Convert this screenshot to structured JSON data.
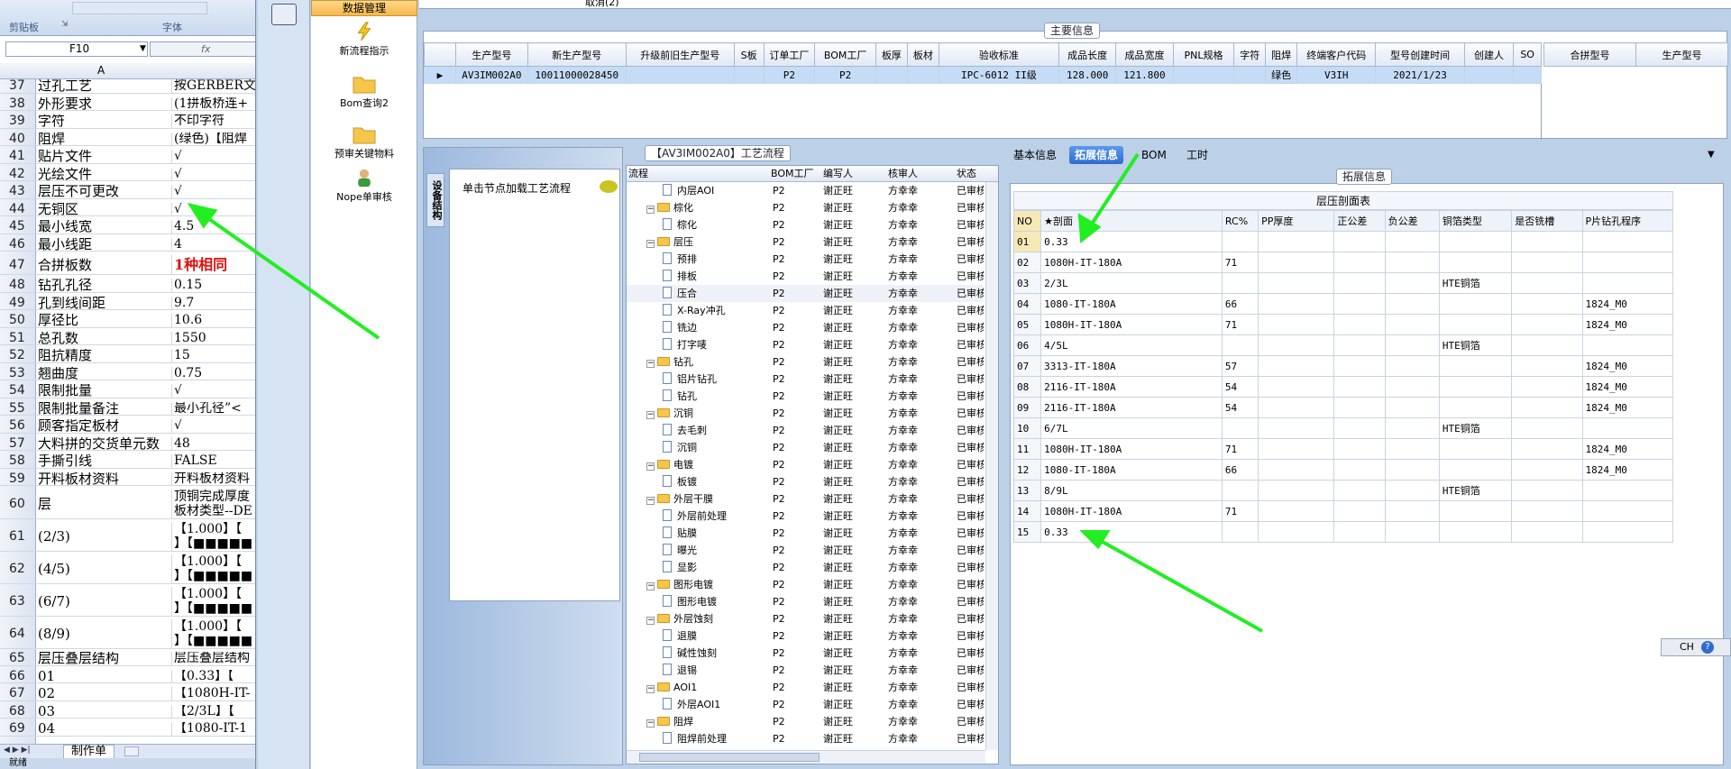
{
  "excel": {
    "ribbon": {
      "clipboard": "剪贴板",
      "font": "字体"
    },
    "namebox": "F10",
    "fx": "fx",
    "col_a": "A",
    "rows": [
      {
        "n": "37",
        "a": "过孔工艺",
        "b": "按GERBER文件"
      },
      {
        "n": "38",
        "a": "外形要求",
        "b": "(1拼板桥连+"
      },
      {
        "n": "39",
        "a": "字符",
        "b": "不印字符"
      },
      {
        "n": "40",
        "a": "阻焊",
        "b": "(绿色)【阻焊"
      },
      {
        "n": "41",
        "a": "贴片文件",
        "b": "√"
      },
      {
        "n": "42",
        "a": "光绘文件",
        "b": "√"
      },
      {
        "n": "43",
        "a": "层压不可更改",
        "b": "√"
      },
      {
        "n": "44",
        "a": "无铜区",
        "b": "√"
      },
      {
        "n": "45",
        "a": "最小线宽",
        "b": "4.5"
      },
      {
        "n": "46",
        "a": "最小线距",
        "b": "4"
      },
      {
        "n": "47",
        "a": "合拼板数",
        "b": "1种相同"
      },
      {
        "n": "48",
        "a": "钻孔孔径",
        "b": "0.15"
      },
      {
        "n": "49",
        "a": "孔到线间距",
        "b": "9.7"
      },
      {
        "n": "50",
        "a": "厚径比",
        "b": "10.6"
      },
      {
        "n": "51",
        "a": "总孔数",
        "b": "1550"
      },
      {
        "n": "52",
        "a": "阻抗精度",
        "b": "15"
      },
      {
        "n": "53",
        "a": "翘曲度",
        "b": "0.75"
      },
      {
        "n": "54",
        "a": "限制批量",
        "b": "√"
      },
      {
        "n": "55",
        "a": "限制批量备注",
        "b": "最小孔径”<"
      },
      {
        "n": "56",
        "a": "顾客指定板材",
        "b": "√"
      },
      {
        "n": "57",
        "a": "大料拼的交货单元数",
        "b": "48"
      },
      {
        "n": "58",
        "a": "手撕引线",
        "b": "FALSE"
      },
      {
        "n": "59",
        "a": "开料板材资料",
        "b": "开料板材资料"
      },
      {
        "n": "60",
        "a": "层",
        "b": "顶铜完成厚度",
        "b2": "板材类型--DE"
      },
      {
        "n": "61",
        "a": "(2/3)",
        "b": "【1.000】【",
        "b2": "】【■■■■■"
      },
      {
        "n": "62",
        "a": "(4/5)",
        "b": "【1.000】【",
        "b2": "】【■■■■■"
      },
      {
        "n": "63",
        "a": "(6/7)",
        "b": "【1.000】【",
        "b2": "】【■■■■■"
      },
      {
        "n": "64",
        "a": "(8/9)",
        "b": "【1.000】【",
        "b2": "】【■■■■■"
      },
      {
        "n": "65",
        "a": "层压叠层结构",
        "b": "层压叠层结构"
      },
      {
        "n": "66",
        "a": "01",
        "b": "【0.33】【"
      },
      {
        "n": "67",
        "a": "02",
        "b": "【1080H-IT-"
      },
      {
        "n": "68",
        "a": "03",
        "b": "【2/3L】【"
      },
      {
        "n": "69",
        "a": "04",
        "b": "【1080-IT-1"
      }
    ],
    "sheet_tab": "制作单",
    "status": "就绪"
  },
  "nav": {
    "top_tab": "数据管理",
    "items": [
      "新流程指示",
      "Bom查询2",
      "预审关键物料",
      "Nope单审核"
    ]
  },
  "main": {
    "top_cut": "取消(2)",
    "info_caption": "主要信息",
    "info_headers": [
      "生产型号",
      "新生产型号",
      "升级前旧生产型号",
      "S板",
      "订单工厂",
      "BOM工厂",
      "板厚",
      "板材",
      "验收标准",
      "成品长度",
      "成品宽度",
      "PNL规格",
      "字符",
      "阻焊",
      "终端客户代码",
      "型号创建时间",
      "创建人",
      "SO"
    ],
    "info_row": [
      "AV3IM002A0",
      "10011000028450",
      "",
      "",
      "P2",
      "P2",
      "",
      "",
      "IPC-6012 II级",
      "128.000",
      "121.800",
      "",
      "",
      "绿色",
      "V3IH",
      "2021/1/23",
      "",
      ""
    ],
    "merge_headers": [
      "合拼型号",
      "生产型号"
    ],
    "flow_caption": "【AV3IM002A0】工艺流程",
    "side_tab": "设备结构",
    "click_hint": "单击节点加载工艺流程",
    "tree_headers": [
      "流程",
      "BOM工厂",
      "编写人",
      "核审人",
      "状态"
    ],
    "tree": [
      {
        "lvl": 2,
        "type": "doc",
        "name": "内层AOI",
        "f": "P2",
        "w": "谢正旺",
        "r": "方幸幸",
        "s": "已审核"
      },
      {
        "lvl": 1,
        "type": "folder",
        "name": "棕化",
        "f": "P2",
        "w": "谢正旺",
        "r": "方幸幸",
        "s": "已审核"
      },
      {
        "lvl": 2,
        "type": "doc",
        "name": "棕化",
        "f": "P2",
        "w": "谢正旺",
        "r": "方幸幸",
        "s": "已审核"
      },
      {
        "lvl": 1,
        "type": "folder",
        "name": "层压",
        "f": "P2",
        "w": "谢正旺",
        "r": "方幸幸",
        "s": "已审核"
      },
      {
        "lvl": 2,
        "type": "doc",
        "name": "预排",
        "f": "P2",
        "w": "谢正旺",
        "r": "方幸幸",
        "s": "已审核"
      },
      {
        "lvl": 2,
        "type": "doc",
        "name": "排板",
        "f": "P2",
        "w": "谢正旺",
        "r": "方幸幸",
        "s": "已审核"
      },
      {
        "lvl": 2,
        "type": "doc",
        "name": "压合",
        "f": "P2",
        "w": "谢正旺",
        "r": "方幸幸",
        "s": "已审核"
      },
      {
        "lvl": 2,
        "type": "doc",
        "name": "X-Ray冲孔",
        "f": "P2",
        "w": "谢正旺",
        "r": "方幸幸",
        "s": "已审核"
      },
      {
        "lvl": 2,
        "type": "doc",
        "name": "铣边",
        "f": "P2",
        "w": "谢正旺",
        "r": "方幸幸",
        "s": "已审核"
      },
      {
        "lvl": 2,
        "type": "doc",
        "name": "打字唛",
        "f": "P2",
        "w": "谢正旺",
        "r": "方幸幸",
        "s": "已审核"
      },
      {
        "lvl": 1,
        "type": "folder",
        "name": "钻孔",
        "f": "P2",
        "w": "谢正旺",
        "r": "方幸幸",
        "s": "已审核"
      },
      {
        "lvl": 2,
        "type": "doc",
        "name": "铝片钻孔",
        "f": "P2",
        "w": "谢正旺",
        "r": "方幸幸",
        "s": "已审核"
      },
      {
        "lvl": 2,
        "type": "doc",
        "name": "钻孔",
        "f": "P2",
        "w": "谢正旺",
        "r": "方幸幸",
        "s": "已审核"
      },
      {
        "lvl": 1,
        "type": "folder",
        "name": "沉铜",
        "f": "P2",
        "w": "谢正旺",
        "r": "方幸幸",
        "s": "已审核"
      },
      {
        "lvl": 2,
        "type": "doc",
        "name": "去毛刺",
        "f": "P2",
        "w": "谢正旺",
        "r": "方幸幸",
        "s": "已审核"
      },
      {
        "lvl": 2,
        "type": "doc",
        "name": "沉铜",
        "f": "P2",
        "w": "谢正旺",
        "r": "方幸幸",
        "s": "已审核"
      },
      {
        "lvl": 1,
        "type": "folder",
        "name": "电镀",
        "f": "P2",
        "w": "谢正旺",
        "r": "方幸幸",
        "s": "已审核"
      },
      {
        "lvl": 2,
        "type": "doc",
        "name": "板镀",
        "f": "P2",
        "w": "谢正旺",
        "r": "方幸幸",
        "s": "已审核"
      },
      {
        "lvl": 1,
        "type": "folder",
        "name": "外层干膜",
        "f": "P2",
        "w": "谢正旺",
        "r": "方幸幸",
        "s": "已审核"
      },
      {
        "lvl": 2,
        "type": "doc",
        "name": "外层前处理",
        "f": "P2",
        "w": "谢正旺",
        "r": "方幸幸",
        "s": "已审核"
      },
      {
        "lvl": 2,
        "type": "doc",
        "name": "贴膜",
        "f": "P2",
        "w": "谢正旺",
        "r": "方幸幸",
        "s": "已审核"
      },
      {
        "lvl": 2,
        "type": "doc",
        "name": "曝光",
        "f": "P2",
        "w": "谢正旺",
        "r": "方幸幸",
        "s": "已审核"
      },
      {
        "lvl": 2,
        "type": "doc",
        "name": "显影",
        "f": "P2",
        "w": "谢正旺",
        "r": "方幸幸",
        "s": "已审核"
      },
      {
        "lvl": 1,
        "type": "folder",
        "name": "图形电镀",
        "f": "P2",
        "w": "谢正旺",
        "r": "方幸幸",
        "s": "已审核"
      },
      {
        "lvl": 2,
        "type": "doc",
        "name": "图形电镀",
        "f": "P2",
        "w": "谢正旺",
        "r": "方幸幸",
        "s": "已审核"
      },
      {
        "lvl": 1,
        "type": "folder",
        "name": "外层蚀刻",
        "f": "P2",
        "w": "谢正旺",
        "r": "方幸幸",
        "s": "已审核"
      },
      {
        "lvl": 2,
        "type": "doc",
        "name": "退膜",
        "f": "P2",
        "w": "谢正旺",
        "r": "方幸幸",
        "s": "已审核"
      },
      {
        "lvl": 2,
        "type": "doc",
        "name": "碱性蚀刻",
        "f": "P2",
        "w": "谢正旺",
        "r": "方幸幸",
        "s": "已审核"
      },
      {
        "lvl": 2,
        "type": "doc",
        "name": "退锡",
        "f": "P2",
        "w": "谢正旺",
        "r": "方幸幸",
        "s": "已审核"
      },
      {
        "lvl": 1,
        "type": "folder",
        "name": "AOI1",
        "f": "P2",
        "w": "谢正旺",
        "r": "方幸幸",
        "s": "已审核"
      },
      {
        "lvl": 2,
        "type": "doc",
        "name": "外层AOI1",
        "f": "P2",
        "w": "谢正旺",
        "r": "方幸幸",
        "s": "已审核"
      },
      {
        "lvl": 1,
        "type": "folder",
        "name": "阻焊",
        "f": "P2",
        "w": "谢正旺",
        "r": "方幸幸",
        "s": "已审核"
      },
      {
        "lvl": 2,
        "type": "doc",
        "name": "阻焊前处理",
        "f": "P2",
        "w": "谢正旺",
        "r": "方幸幸",
        "s": "已审核"
      }
    ],
    "tabs": [
      "基本信息",
      "拓展信息",
      "BOM",
      "工时"
    ],
    "active_tab": "拓展信息",
    "ext_caption": "拓展信息",
    "stack_title": "层压剖面表",
    "stack_headers": [
      "NO",
      "★剖面",
      "RC%",
      "PP厚度",
      "正公差",
      "负公差",
      "铜箔类型",
      "是否铣槽",
      "P片钻孔程序"
    ],
    "stack_rows": [
      [
        "01",
        "0.33",
        "",
        "",
        "",
        "",
        "",
        "",
        ""
      ],
      [
        "02",
        "1080H-IT-180A",
        "71",
        "",
        "",
        "",
        "",
        "",
        ""
      ],
      [
        "03",
        "2/3L",
        "",
        "",
        "",
        "",
        "HTE铜箔",
        "",
        ""
      ],
      [
        "04",
        "1080-IT-180A",
        "66",
        "",
        "",
        "",
        "",
        "",
        "1824_M0"
      ],
      [
        "05",
        "1080H-IT-180A",
        "71",
        "",
        "",
        "",
        "",
        "",
        "1824_M0"
      ],
      [
        "06",
        "4/5L",
        "",
        "",
        "",
        "",
        "HTE铜箔",
        "",
        ""
      ],
      [
        "07",
        "3313-IT-180A",
        "57",
        "",
        "",
        "",
        "",
        "",
        "1824_M0"
      ],
      [
        "08",
        "2116-IT-180A",
        "54",
        "",
        "",
        "",
        "",
        "",
        "1824_M0"
      ],
      [
        "09",
        "2116-IT-180A",
        "54",
        "",
        "",
        "",
        "",
        "",
        "1824_M0"
      ],
      [
        "10",
        "6/7L",
        "",
        "",
        "",
        "",
        "HTE铜箔",
        "",
        ""
      ],
      [
        "11",
        "1080H-IT-180A",
        "71",
        "",
        "",
        "",
        "",
        "",
        "1824_M0"
      ],
      [
        "12",
        "1080-IT-180A",
        "66",
        "",
        "",
        "",
        "",
        "",
        "1824_M0"
      ],
      [
        "13",
        "8/9L",
        "",
        "",
        "",
        "",
        "HTE铜箔",
        "",
        ""
      ],
      [
        "14",
        "1080H-IT-180A",
        "71",
        "",
        "",
        "",
        "",
        "",
        ""
      ],
      [
        "15",
        "0.33",
        "",
        "",
        "",
        "",
        "",
        "",
        ""
      ]
    ],
    "ime": "CH"
  },
  "colors": {
    "accent": "#3a78c8",
    "arrow": "#22ee22",
    "selected_row": "#c5dcf6",
    "red_text": "#e01010"
  }
}
